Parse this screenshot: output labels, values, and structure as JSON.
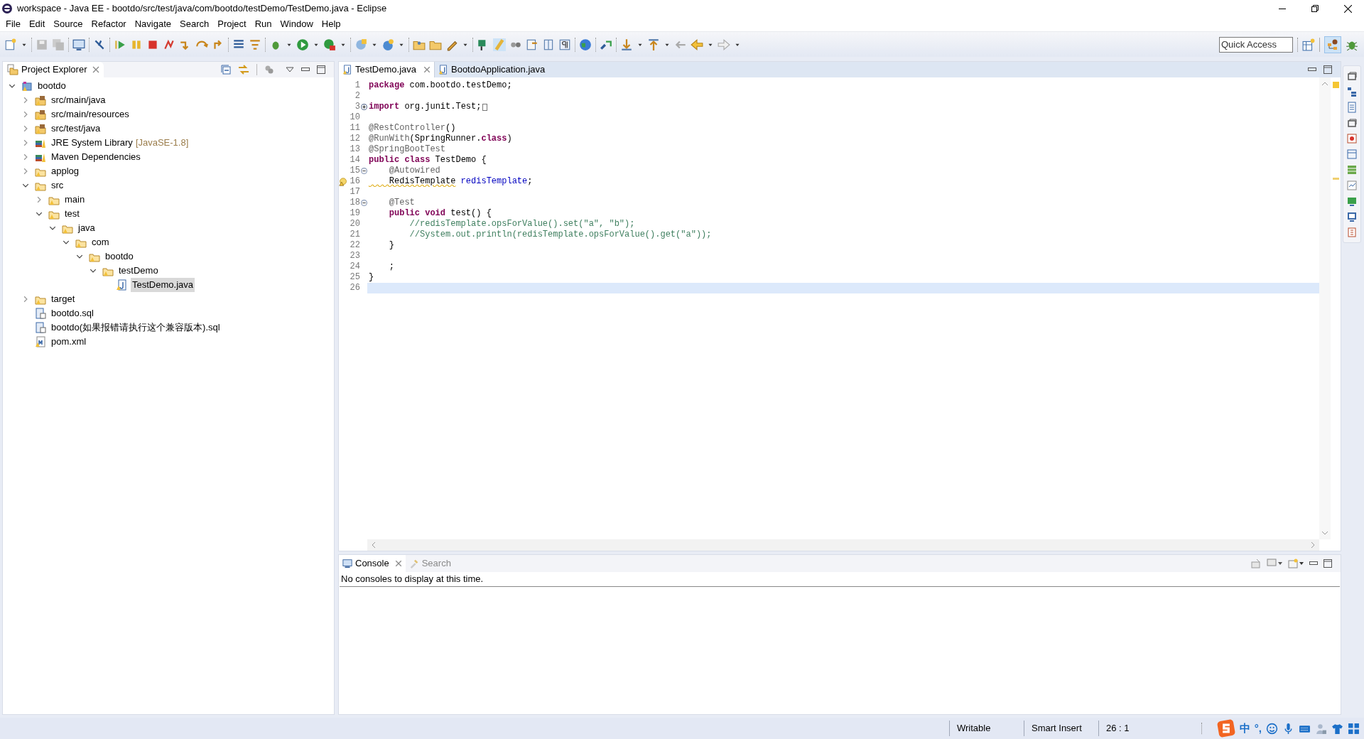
{
  "window": {
    "title": "workspace - Java EE - bootdo/src/test/java/com/bootdo/testDemo/TestDemo.java - Eclipse"
  },
  "menu": [
    "File",
    "Edit",
    "Source",
    "Refactor",
    "Navigate",
    "Search",
    "Project",
    "Run",
    "Window",
    "Help"
  ],
  "quick_access": {
    "placeholder": "Quick Access"
  },
  "project_explorer": {
    "title": "Project Explorer",
    "tree": [
      {
        "label": "bootdo",
        "kind": "project",
        "expanded": true,
        "selected": false,
        "children": [
          {
            "label": "src/main/java",
            "kind": "source-folder",
            "expanded": false,
            "selected": false
          },
          {
            "label": "src/main/resources",
            "kind": "source-folder",
            "expanded": false,
            "selected": false
          },
          {
            "label": "src/test/java",
            "kind": "source-folder",
            "expanded": false,
            "selected": false
          },
          {
            "label": "JRE System Library",
            "decoration": "[JavaSE-1.8]",
            "kind": "library",
            "expanded": false,
            "selected": false
          },
          {
            "label": "Maven Dependencies",
            "kind": "library",
            "expanded": false,
            "selected": false
          },
          {
            "label": "applog",
            "kind": "folder",
            "expanded": false,
            "selected": false
          },
          {
            "label": "src",
            "kind": "folder",
            "expanded": true,
            "selected": false,
            "children": [
              {
                "label": "main",
                "kind": "folder",
                "expanded": false,
                "selected": false
              },
              {
                "label": "test",
                "kind": "folder",
                "expanded": true,
                "selected": false,
                "children": [
                  {
                    "label": "java",
                    "kind": "folder",
                    "expanded": true,
                    "selected": false,
                    "children": [
                      {
                        "label": "com",
                        "kind": "folder",
                        "expanded": true,
                        "selected": false,
                        "children": [
                          {
                            "label": "bootdo",
                            "kind": "folder",
                            "expanded": true,
                            "selected": false,
                            "children": [
                              {
                                "label": "testDemo",
                                "kind": "folder",
                                "expanded": true,
                                "selected": false,
                                "children": [
                                  {
                                    "label": "TestDemo.java",
                                    "kind": "java-file",
                                    "selected": true
                                  }
                                ]
                              }
                            ]
                          }
                        ]
                      }
                    ]
                  }
                ]
              }
            ]
          },
          {
            "label": "target",
            "kind": "folder",
            "expanded": false,
            "selected": false
          },
          {
            "label": "bootdo.sql",
            "kind": "sql-file",
            "selected": false
          },
          {
            "label": "bootdo(如果报错请执行这个兼容版本).sql",
            "kind": "sql-file",
            "selected": false
          },
          {
            "label": "pom.xml",
            "kind": "xml-file",
            "selected": false
          }
        ]
      }
    ]
  },
  "editor": {
    "tabs": [
      {
        "label": "TestDemo.java",
        "selected": true
      },
      {
        "label": "BootdoApplication.java",
        "selected": false
      }
    ],
    "lines": [
      {
        "number": "1",
        "kind": "plain",
        "current": false,
        "tokens": [
          {
            "kind": "keyword",
            "text": "package"
          },
          {
            "kind": "plain",
            "text": " com.bootdo.testDemo;"
          }
        ]
      },
      {
        "number": "2",
        "kind": "plain",
        "current": false
      },
      {
        "number": "3",
        "kind": "folded",
        "current": false,
        "tokens": [
          {
            "kind": "keyword",
            "text": "import"
          },
          {
            "kind": "plain",
            "text": " org.junit.Test;"
          }
        ]
      },
      {
        "number": "10",
        "kind": "plain",
        "current": false
      },
      {
        "number": "11",
        "kind": "plain",
        "current": false,
        "tokens": [
          {
            "kind": "annotation",
            "text": "@RestController"
          },
          {
            "kind": "plain",
            "text": "()"
          }
        ]
      },
      {
        "number": "12",
        "kind": "plain",
        "current": false,
        "tokens": [
          {
            "kind": "annotation",
            "text": "@RunWith"
          },
          {
            "kind": "plain",
            "text": "(SpringRunner."
          },
          {
            "kind": "keyword",
            "text": "class"
          },
          {
            "kind": "plain",
            "text": ")"
          }
        ]
      },
      {
        "number": "13",
        "kind": "plain",
        "current": false,
        "tokens": [
          {
            "kind": "annotation",
            "text": "@SpringBootTest"
          }
        ]
      },
      {
        "number": "14",
        "kind": "plain",
        "current": false,
        "tokens": [
          {
            "kind": "keyword",
            "text": "public class"
          },
          {
            "kind": "plain",
            "text": " TestDemo {"
          }
        ]
      },
      {
        "number": "15",
        "kind": "fold-start",
        "current": false,
        "tokens": [
          {
            "kind": "annotation",
            "text": "    @Autowired"
          }
        ]
      },
      {
        "number": "16",
        "kind": "warning",
        "current": false,
        "tokens": [
          {
            "kind": "warning",
            "text": "    RedisTemplate"
          },
          {
            "kind": "field",
            "text": " redisTemplate"
          },
          {
            "kind": "plain",
            "text": ";"
          }
        ]
      },
      {
        "number": "17",
        "kind": "plain",
        "current": false
      },
      {
        "number": "18",
        "kind": "fold-start",
        "current": false,
        "tokens": [
          {
            "kind": "annotation",
            "text": "    @Test"
          }
        ]
      },
      {
        "number": "19",
        "kind": "plain",
        "current": false,
        "tokens": [
          {
            "kind": "keyword",
            "text": "    public void"
          },
          {
            "kind": "plain",
            "text": " test() {"
          }
        ]
      },
      {
        "number": "20",
        "kind": "plain",
        "current": false,
        "tokens": [
          {
            "kind": "comment",
            "text": "        //redisTemplate.opsForValue().set(\"a\", \"b\");"
          }
        ]
      },
      {
        "number": "21",
        "kind": "plain",
        "current": false,
        "tokens": [
          {
            "kind": "comment",
            "text": "        //System.out.println(redisTemplate.opsForValue().get(\"a\"));"
          }
        ]
      },
      {
        "number": "22",
        "kind": "plain",
        "current": false,
        "tokens": [
          {
            "kind": "plain",
            "text": "    }"
          }
        ]
      },
      {
        "number": "23",
        "kind": "plain",
        "current": false
      },
      {
        "number": "24",
        "kind": "plain",
        "current": false,
        "tokens": [
          {
            "kind": "plain",
            "text": "    ;"
          }
        ]
      },
      {
        "number": "25",
        "kind": "plain",
        "current": false,
        "tokens": [
          {
            "kind": "plain",
            "text": "}"
          }
        ]
      },
      {
        "number": "26",
        "kind": "plain",
        "current": true
      }
    ]
  },
  "console": {
    "tabs": [
      {
        "label": "Console",
        "selected": true
      },
      {
        "label": "Search",
        "selected": false
      }
    ],
    "message": "No consoles to display at this time."
  },
  "status_bar": {
    "fields": [
      "Writable",
      "Smart Insert",
      "26 : 1"
    ],
    "tray_texts": [
      "中",
      "°,"
    ]
  }
}
